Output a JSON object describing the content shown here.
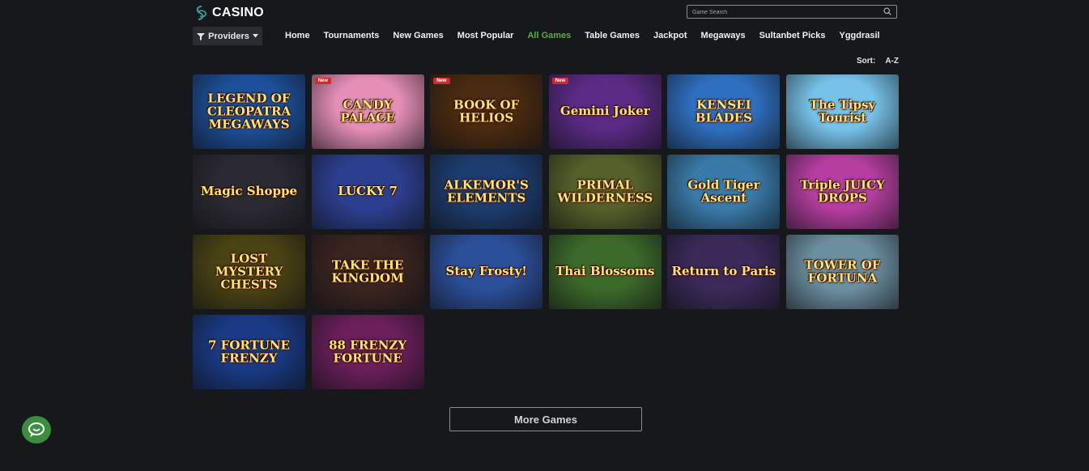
{
  "brand": {
    "title": "CASINO",
    "icon": "casino-logo-icon",
    "accent": "#3aa2a0"
  },
  "search": {
    "placeholder": "Game Search",
    "icon": "search-icon"
  },
  "providers": {
    "label": "Providers",
    "icon": "filter-icon",
    "caret": "chevron-down-icon"
  },
  "nav": [
    {
      "label": "Home"
    },
    {
      "label": "Tournaments"
    },
    {
      "label": "New Games"
    },
    {
      "label": "Most Popular"
    },
    {
      "label": "All Games",
      "active": true
    },
    {
      "label": "Table Games"
    },
    {
      "label": "Jackpot"
    },
    {
      "label": "Megaways"
    },
    {
      "label": "Sultanbet Picks"
    },
    {
      "label": "Yggdrasil"
    }
  ],
  "sort": {
    "label": "Sort:",
    "value": "A-Z"
  },
  "games": [
    {
      "title": "LEGEND OF CLEOPATRA MEGAWAYS",
      "badge": "",
      "bg": "#1d4f9a"
    },
    {
      "title": "CANDY PALACE",
      "badge": "New",
      "bg": "#e58fb6"
    },
    {
      "title": "BOOK OF HELIOS",
      "badge": "New",
      "bg": "#4a2a10"
    },
    {
      "title": "Gemini Joker",
      "badge": "New",
      "bg": "#5a2a84"
    },
    {
      "title": "KENSEI BLADES",
      "badge": "",
      "bg": "#2f6fbf"
    },
    {
      "title": "The Tipsy Tourist",
      "badge": "",
      "bg": "#77c2e8"
    },
    {
      "title": "Magic Shoppe",
      "badge": "",
      "bg": "#2b2a33"
    },
    {
      "title": "LUCKY 7",
      "badge": "",
      "bg": "#2c3f8f"
    },
    {
      "title": "ALKEMOR'S ELEMENTS",
      "badge": "",
      "bg": "#1d3c6e"
    },
    {
      "title": "PRIMAL WILDERNESS",
      "badge": "",
      "bg": "#55602a"
    },
    {
      "title": "Gold Tiger Ascent",
      "badge": "",
      "bg": "#3a7aa8"
    },
    {
      "title": "Triple JUICY DROPS",
      "badge": "",
      "bg": "#b53ea0"
    },
    {
      "title": "LOST MYSTERY CHESTS",
      "badge": "",
      "bg": "#4a4314"
    },
    {
      "title": "TAKE THE KINGDOM",
      "badge": "",
      "bg": "#3a2420"
    },
    {
      "title": "Stay Frosty!",
      "badge": "",
      "bg": "#2c4f9a"
    },
    {
      "title": "Thai Blossoms",
      "badge": "",
      "bg": "#3c6a2a"
    },
    {
      "title": "Return to Paris",
      "badge": "",
      "bg": "#3b2a5a"
    },
    {
      "title": "TOWER OF FORTUNA",
      "badge": "",
      "bg": "#6c8fa0"
    },
    {
      "title": "7 FORTUNE FRENZY",
      "badge": "",
      "bg": "#1a3a86"
    },
    {
      "title": "88 FRENZY FORTUNE",
      "badge": "",
      "bg": "#6a1f5a"
    }
  ],
  "more_games": {
    "label": "More Games"
  },
  "chat": {
    "icon": "chat-icon",
    "color": "#3b8d3f"
  }
}
